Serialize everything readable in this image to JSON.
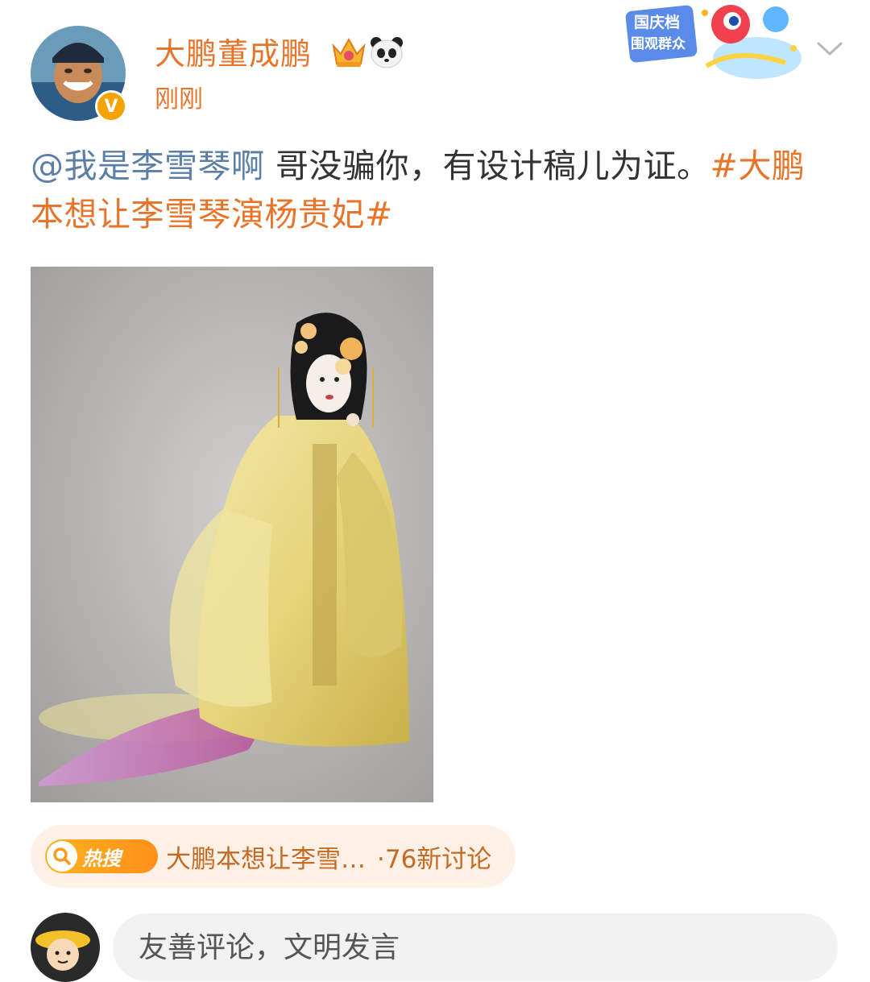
{
  "post": {
    "author_name": "大鹏董成鹏",
    "verified_badge": "V",
    "time": "刚刚",
    "mention": "@我是李雪琴啊",
    "body": " 哥没骗你，有设计稿儿为证。",
    "hashtag": "#大鹏本想让李雪琴演杨贵妃#",
    "image_alt": "costume-design-illustration"
  },
  "event_badge": {
    "line1": "国庆档",
    "line2": "围观群众"
  },
  "hot_search": {
    "tag_label": "热搜",
    "title": "大鹏本想让李雪…",
    "count": "·76新讨论"
  },
  "comment": {
    "placeholder": "友善评论，文明发言"
  },
  "colors": {
    "accent": "#e8742a",
    "mention": "#5b7fa6",
    "chip_bg": "#fdf1e6",
    "input_bg": "#f2f2f2"
  },
  "icons": [
    "crown-icon",
    "panda-icon",
    "chevron-down-icon",
    "search-icon",
    "verified-icon"
  ]
}
